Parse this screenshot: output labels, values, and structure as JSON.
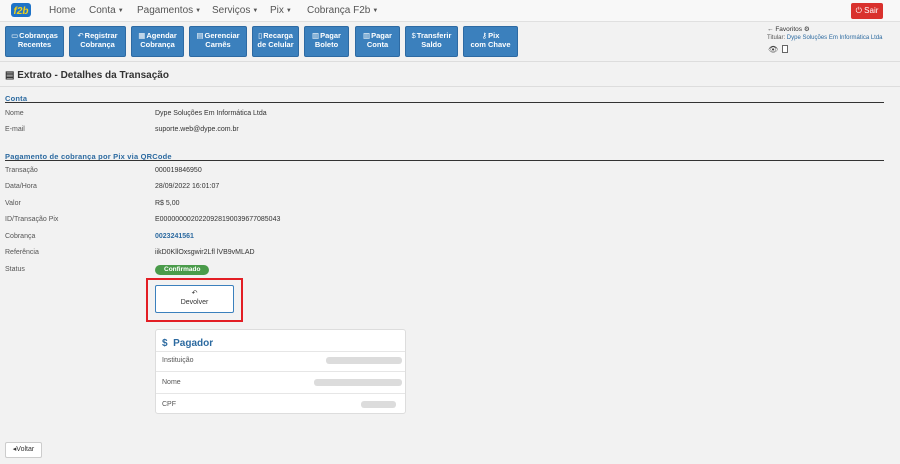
{
  "navbar": {
    "brand": "f2b",
    "items": [
      {
        "label": "Home",
        "dropdown": false
      },
      {
        "label": "Conta",
        "dropdown": true
      },
      {
        "label": "Pagamentos",
        "dropdown": true
      },
      {
        "label": "Serviços",
        "dropdown": true
      },
      {
        "label": "Pix",
        "dropdown": true
      },
      {
        "label": "Cobrança F2b",
        "dropdown": true
      }
    ],
    "logout_label": "Sair"
  },
  "toolbar": {
    "buttons": [
      {
        "line1": "Cobranças",
        "line2": "Recentes",
        "icon": "folder-icon"
      },
      {
        "line1": "Registrar",
        "line2": "Cobrança",
        "icon": "reply-icon"
      },
      {
        "line1": "Agendar",
        "line2": "Cobrança",
        "icon": "calendar-icon"
      },
      {
        "line1": "Gerenciar",
        "line2": "Carnês",
        "icon": "list-icon"
      },
      {
        "line1": "Recarga",
        "line2": "de Celular",
        "icon": "phone-icon"
      },
      {
        "line1": "Pagar",
        "line2": "Boleto",
        "icon": "barcode-icon"
      },
      {
        "line1": "Pagar",
        "line2": "Conta",
        "icon": "barcode-icon"
      },
      {
        "line1": "Transferir",
        "line2": "Saldo",
        "icon": "dollar-icon"
      },
      {
        "line1": "Pix",
        "line2": "com Chave",
        "icon": "key-icon"
      }
    ],
    "favorites_label": "Favoritos",
    "titular_label": "Titular:",
    "titular_name": "Dype Soluções Em Informática Ltda"
  },
  "page": {
    "title": "Extrato - Detalhes da Transação",
    "conta_section": "Conta",
    "conta": [
      {
        "label": "Nome",
        "value": "Dype Soluções Em Informática Ltda"
      },
      {
        "label": "E-mail",
        "value": "suporte.web@dype.com.br"
      }
    ],
    "pix_section": "Pagamento de cobrança por Pix via QRCode",
    "transacao": [
      {
        "label": "Transação",
        "value": "000019846950"
      },
      {
        "label": "Data/Hora",
        "value": "28/09/2022 16:01:07"
      },
      {
        "label": "Valor",
        "value": "R$ 5,00"
      },
      {
        "label": "ID/Transação Pix",
        "value": "E00000000202209281900396770850​43"
      },
      {
        "label": "Cobrança",
        "value": "0023241561"
      },
      {
        "label": "Referência",
        "value": "iikD0KllOxsgwir2Lfl lVB9vMLAD"
      }
    ],
    "status_label": "Status",
    "status_value": "Confirmado",
    "devolver_label": "Devolver",
    "pagador": {
      "title": "Pagador",
      "rows": [
        "Instituição",
        "Nome",
        "CPF"
      ]
    },
    "voltar_label": "Voltar"
  },
  "colors": {
    "primary": "#3b80bd",
    "link": "#2c6aa0",
    "danger": "#d9312d",
    "success": "#4a9b4a",
    "highlight": "#e31e24"
  }
}
